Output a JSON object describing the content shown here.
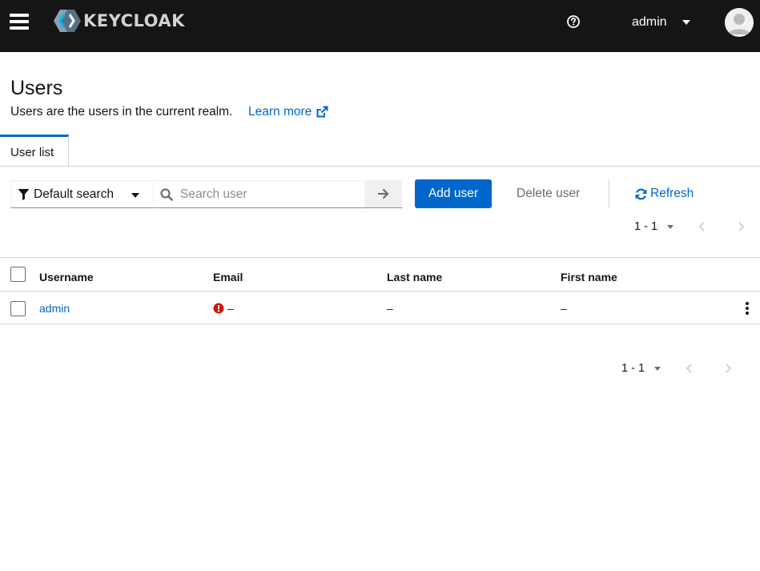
{
  "header": {
    "logo_text": "KEYCLOAK",
    "username": "admin",
    "icons": {
      "menu": "hamburger-icon",
      "help": "help-circle-icon",
      "user_caret": "caret-down-icon",
      "avatar": "user-avatar"
    }
  },
  "page": {
    "title": "Users",
    "description": "Users are the users in the current realm.",
    "learn_more": "Learn more"
  },
  "tabs": [
    {
      "label": "User list",
      "active": true
    }
  ],
  "toolbar": {
    "search_type": "Default search",
    "search_placeholder": "Search user",
    "add_user": "Add user",
    "delete_user": "Delete user",
    "refresh": "Refresh"
  },
  "pagination": {
    "top_range": "1 - 1",
    "bottom_range": "1 - 1"
  },
  "table": {
    "columns": [
      "Username",
      "Email",
      "Last name",
      "First name"
    ],
    "rows": [
      {
        "username": "admin",
        "email": "–",
        "email_status": "not-verified",
        "last_name": "–",
        "first_name": "–"
      }
    ]
  },
  "colors": {
    "masthead": "#151515",
    "primary": "#0066cc",
    "danger": "#c9190b",
    "border": "#d2d2d2"
  }
}
